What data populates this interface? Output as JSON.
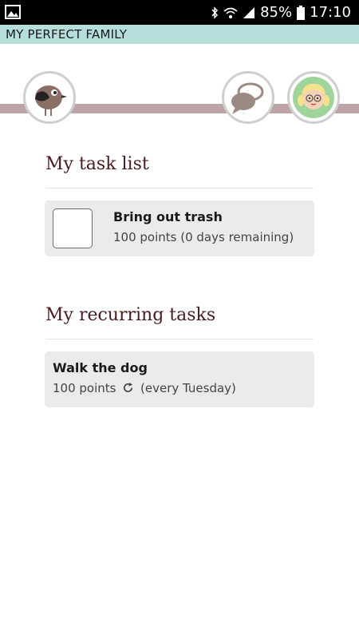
{
  "status_bar": {
    "battery_percent": "85%",
    "time": "17:10",
    "icons": [
      "gallery-icon",
      "bluetooth-icon",
      "wifi-icon",
      "signal-icon",
      "battery-icon"
    ]
  },
  "app": {
    "title": "MY PERFECT FAMILY"
  },
  "header": {
    "icons": [
      "bird-logo-icon",
      "chat-bubbles-icon",
      "avatar-girl-icon"
    ],
    "band_color": "#bda4a6"
  },
  "task_list": {
    "title": "My task list",
    "items": [
      {
        "name": "Bring out trash",
        "meta": "100 points (0 days remaining)",
        "checked": false
      }
    ]
  },
  "recurring": {
    "title": "My recurring tasks",
    "items": [
      {
        "name": "Walk the dog",
        "points": "100 points",
        "schedule": "(every Tuesday)",
        "icon": "recurring-icon"
      }
    ]
  },
  "colors": {
    "heading": "#4a1b1e",
    "title_bar": "#b6dedd",
    "card": "#ebebeb"
  }
}
